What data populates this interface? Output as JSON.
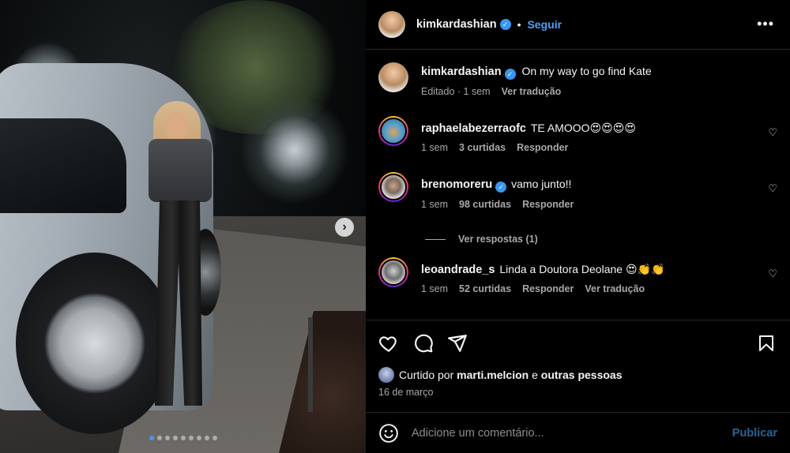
{
  "post": {
    "slide_count": 9,
    "active_slide": 1
  },
  "header": {
    "username": "kimkardashian",
    "verified": true,
    "dot": "•",
    "follow_label": "Seguir",
    "more_icon": "more-horizontal-icon"
  },
  "caption": {
    "username": "kimkardashian",
    "text": "On my way to go find Kate",
    "edited": "Editado",
    "time": "1 sem",
    "translate": "Ver tradução"
  },
  "comments": [
    {
      "username": "raphaelabezerraofc",
      "text": "TE AMOOO😍😍😍😍",
      "time": "1 sem",
      "likes": "3 curtidas",
      "reply": "Responder"
    },
    {
      "username": "brenomoreru",
      "text": "vamo junto!!",
      "time": "1 sem",
      "likes": "98 curtidas",
      "reply": "Responder",
      "view_replies": "Ver respostas (1)"
    },
    {
      "username": "leoandrade_s",
      "text": "Linda a Doutora Deolane 😍👏👏",
      "time": "1 sem",
      "likes": "52 curtidas",
      "reply": "Responder",
      "translate": "Ver tradução"
    }
  ],
  "actions": {
    "like_icon": "heart-icon",
    "comment_icon": "comment-icon",
    "share_icon": "share-icon",
    "save_icon": "bookmark-icon"
  },
  "likes": {
    "prefix": "Curtido por",
    "user": "marti.melcion",
    "middle": "e",
    "others": "outras pessoas"
  },
  "date": "16 de março",
  "composer": {
    "emoji_icon": "emoji-icon",
    "placeholder": "Adicione um comentário...",
    "publish_label": "Publicar"
  },
  "colors": {
    "accent": "#4aa3f5",
    "verified": "#3897f0",
    "muted": "#a8a8a8",
    "background": "#000000"
  }
}
